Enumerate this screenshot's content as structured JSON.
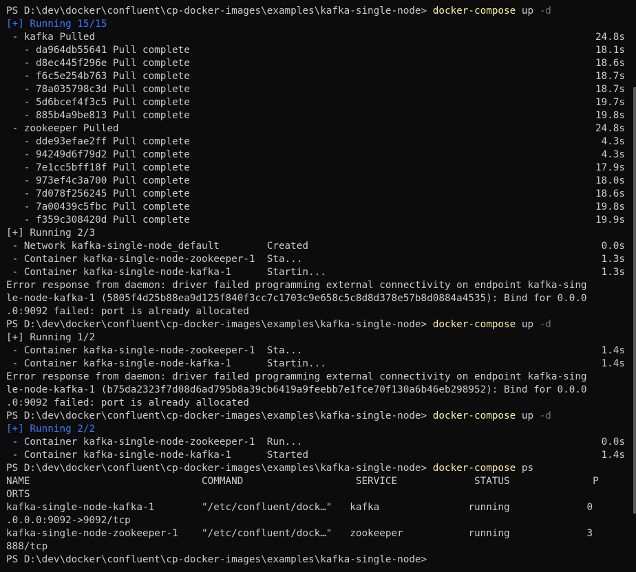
{
  "terminal": {
    "scrollbar": {
      "visible": true
    },
    "colors": {
      "background": "#0c0c0c",
      "text": "#cccccc",
      "command": "#f9f1a5",
      "flag": "#767676",
      "running": "#3b78ff"
    },
    "lines": [
      {
        "type": "prompt",
        "prompt": "PS D:\\dev\\docker\\confluent\\cp-docker-images\\examples\\kafka-single-node> ",
        "cmd": "docker-compose",
        "args": " up ",
        "flag": "-d"
      },
      {
        "type": "blue",
        "text": "[+] Running 15/15"
      },
      {
        "type": "row",
        "text": " - kafka Pulled",
        "right": "24.8s"
      },
      {
        "type": "row",
        "text": "   - da964db55641 Pull complete",
        "right": "18.1s"
      },
      {
        "type": "row",
        "text": "   - d8ec445f296e Pull complete",
        "right": "18.6s"
      },
      {
        "type": "row",
        "text": "   - f6c5e254b763 Pull complete",
        "right": "18.7s"
      },
      {
        "type": "row",
        "text": "   - 78a035798c3d Pull complete",
        "right": "18.7s"
      },
      {
        "type": "row",
        "text": "   - 5d6bcef4f3c5 Pull complete",
        "right": "19.7s"
      },
      {
        "type": "row",
        "text": "   - 885b4a9be813 Pull complete",
        "right": "19.8s"
      },
      {
        "type": "row",
        "text": " - zookeeper Pulled",
        "right": "24.8s"
      },
      {
        "type": "row",
        "text": "   - dde93efae2ff Pull complete",
        "right": "4.3s"
      },
      {
        "type": "row",
        "text": "   - 94249d6f79d2 Pull complete",
        "right": "4.3s"
      },
      {
        "type": "row",
        "text": "   - 7e1cc5bff18f Pull complete",
        "right": "17.9s"
      },
      {
        "type": "row",
        "text": "   - 973ef4c3a700 Pull complete",
        "right": "18.0s"
      },
      {
        "type": "row",
        "text": "   - 7d078f256245 Pull complete",
        "right": "18.6s"
      },
      {
        "type": "row",
        "text": "   - 7a00439c5fbc Pull complete",
        "right": "19.8s"
      },
      {
        "type": "row",
        "text": "   - f359c308420d Pull complete",
        "right": "19.9s"
      },
      {
        "type": "text",
        "text": "[+] Running 2/3"
      },
      {
        "type": "row",
        "text": " - Network kafka-single-node_default        Created",
        "right": "0.0s"
      },
      {
        "type": "row",
        "text": " - Container kafka-single-node-zookeeper-1  Sta...",
        "right": "1.3s"
      },
      {
        "type": "row",
        "text": " - Container kafka-single-node-kafka-1      Startin...",
        "right": "1.3s"
      },
      {
        "type": "text",
        "text": "Error response from daemon: driver failed programming external connectivity on endpoint kafka-sing"
      },
      {
        "type": "text",
        "text": "le-node-kafka-1 (5805f4d25b88ea9d125f840f3cc7c1703c9e658c5c8d8d378e57b8d0884a4535): Bind for 0.0.0"
      },
      {
        "type": "text",
        "text": ".0:9092 failed: port is already allocated"
      },
      {
        "type": "prompt",
        "prompt": "PS D:\\dev\\docker\\confluent\\cp-docker-images\\examples\\kafka-single-node> ",
        "cmd": "docker-compose",
        "args": " up ",
        "flag": "-d"
      },
      {
        "type": "text",
        "text": "[+] Running 1/2"
      },
      {
        "type": "row",
        "text": " - Container kafka-single-node-zookeeper-1  Sta...",
        "right": "1.4s"
      },
      {
        "type": "row",
        "text": " - Container kafka-single-node-kafka-1      Startin...",
        "right": "1.4s"
      },
      {
        "type": "text",
        "text": "Error response from daemon: driver failed programming external connectivity on endpoint kafka-sing"
      },
      {
        "type": "text",
        "text": "le-node-kafka-1 (b75da2323f7d08d6ad795b8a39cb6419a9feebb7e1fce70f130a6b46eb298952): Bind for 0.0.0"
      },
      {
        "type": "text",
        "text": ".0:9092 failed: port is already allocated"
      },
      {
        "type": "prompt",
        "prompt": "PS D:\\dev\\docker\\confluent\\cp-docker-images\\examples\\kafka-single-node> ",
        "cmd": "docker-compose",
        "args": " up ",
        "flag": "-d"
      },
      {
        "type": "blue",
        "text": "[+] Running 2/2"
      },
      {
        "type": "row",
        "text": " - Container kafka-single-node-zookeeper-1  Run...",
        "right": "0.0s"
      },
      {
        "type": "row",
        "text": " - Container kafka-single-node-kafka-1      Started",
        "right": "1.4s"
      },
      {
        "type": "prompt",
        "prompt": "PS D:\\dev\\docker\\confluent\\cp-docker-images\\examples\\kafka-single-node> ",
        "cmd": "docker-compose",
        "args": " ps",
        "flag": ""
      },
      {
        "type": "text",
        "text": "NAME                             COMMAND                   SERVICE             STATUS              P"
      },
      {
        "type": "text",
        "text": "ORTS"
      },
      {
        "type": "text",
        "text": "kafka-single-node-kafka-1        \"/etc/confluent/dock…\"   kafka               running             0"
      },
      {
        "type": "text",
        "text": ".0.0.0:9092->9092/tcp"
      },
      {
        "type": "text",
        "text": "kafka-single-node-zookeeper-1    \"/etc/confluent/dock…\"   zookeeper           running             3"
      },
      {
        "type": "text",
        "text": "888/tcp"
      },
      {
        "type": "prompt",
        "prompt": "PS D:\\dev\\docker\\confluent\\cp-docker-images\\examples\\kafka-single-node> ",
        "cmd": "",
        "args": "",
        "flag": ""
      }
    ]
  }
}
